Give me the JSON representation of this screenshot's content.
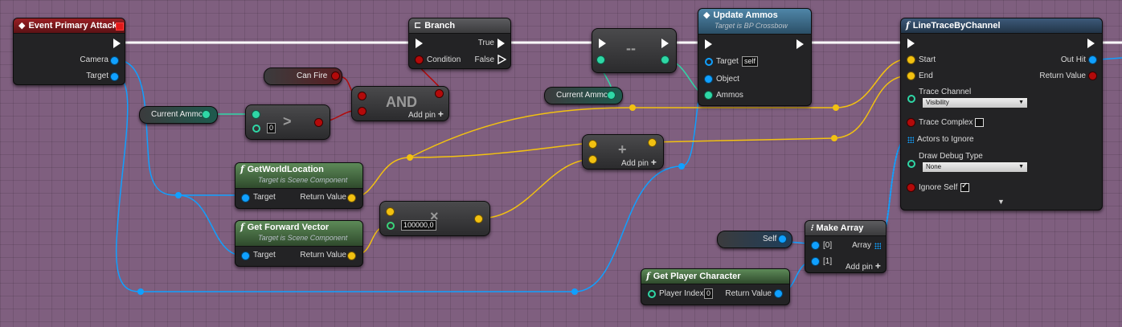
{
  "nodes": {
    "event_primary_attack": {
      "title": "Event Primary Attack",
      "pins": {
        "camera": "Camera",
        "target": "Target"
      }
    },
    "branch": {
      "title": "Branch",
      "pins": {
        "condition": "Condition",
        "true": "True",
        "false": "False"
      }
    },
    "update_ammos": {
      "title": "Update Ammos",
      "subtitle": "Target is BP Crossbow",
      "pins": {
        "target": "Target",
        "target_default": "self",
        "object": "Object",
        "ammos": "Ammos"
      }
    },
    "line_trace": {
      "title": "LineTraceByChannel",
      "pins": {
        "start": "Start",
        "end": "End",
        "out_hit": "Out Hit",
        "return_value": "Return Value",
        "trace_channel": "Trace Channel",
        "trace_channel_value": "Visibility",
        "trace_complex": "Trace Complex",
        "actors_to_ignore": "Actors to Ignore",
        "draw_debug_type": "Draw Debug Type",
        "draw_debug_value": "None",
        "ignore_self": "Ignore Self"
      },
      "trace_complex_checked": false,
      "ignore_self_checked": true,
      "expand_glyph": "▼"
    },
    "and": {
      "label": "AND",
      "add_pin": "Add pin",
      "plus": "+"
    },
    "greater": {
      "symbol": ">",
      "default_value": "0"
    },
    "decrement": {
      "symbol": "--"
    },
    "add": {
      "symbol": "+",
      "add_pin": "Add pin",
      "plus": "+"
    },
    "multiply": {
      "symbol": "×",
      "default_value": "100000,0"
    },
    "get_world_location": {
      "title": "GetWorldLocation",
      "subtitle": "Target is Scene Component",
      "pins": {
        "target": "Target",
        "return_value": "Return Value"
      }
    },
    "get_forward_vector": {
      "title": "Get Forward Vector",
      "subtitle": "Target is Scene Component",
      "pins": {
        "target": "Target",
        "return_value": "Return Value"
      }
    },
    "make_array": {
      "title": "Make Array",
      "pins": {
        "p0": "[0]",
        "p1": "[1]",
        "array": "Array",
        "add_pin": "Add pin",
        "plus": "+"
      }
    },
    "get_player_character": {
      "title": "Get Player Character",
      "pins": {
        "player_index": "Player Index",
        "player_index_default": "0",
        "return_value": "Return Value"
      }
    }
  },
  "variables": {
    "can_fire": "Can Fire",
    "current_ammo_1": "Current Ammo",
    "current_ammo_2": "Current Ammo",
    "self": "Self"
  },
  "colors": {
    "exec": "#ffffff",
    "object": "#10a0ff",
    "vector": "#f2c111",
    "bool": "#b30a0a",
    "int": "#2fd7a6",
    "float": "#a2f08a",
    "background": "#7f5f7f"
  }
}
